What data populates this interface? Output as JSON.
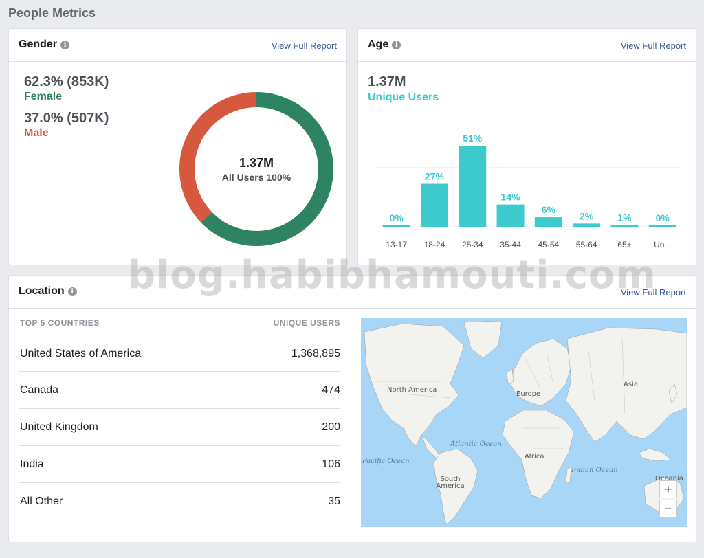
{
  "page": {
    "title": "People Metrics"
  },
  "gender": {
    "title": "Gender",
    "report_link": "View Full Report",
    "female": {
      "value": "62.3% (853K)",
      "label": "Female",
      "percent": 62.3,
      "color": "#2e8362"
    },
    "male": {
      "value": "37.0% (507K)",
      "label": "Male",
      "percent": 37.0,
      "color": "#d6593f"
    },
    "total": "1.37M",
    "total_label": "All Users 100%"
  },
  "age": {
    "title": "Age",
    "report_link": "View Full Report",
    "total": "1.37M",
    "total_label": "Unique Users",
    "accent_color": "#3ccacc"
  },
  "chart_data": {
    "type": "bar",
    "categories": [
      "13-17",
      "18-24",
      "25-34",
      "35-44",
      "45-54",
      "55-64",
      "65+",
      "Un..."
    ],
    "values": [
      0,
      27,
      51,
      14,
      6,
      2,
      1,
      0
    ],
    "data_labels": [
      "0%",
      "27%",
      "51%",
      "14%",
      "6%",
      "2%",
      "1%",
      "0%"
    ],
    "ylim": [
      0,
      51
    ],
    "grid": true
  },
  "location": {
    "title": "Location",
    "report_link": "View Full Report",
    "col_country": "TOP 5 COUNTRIES",
    "col_users": "UNIQUE USERS",
    "rows": [
      {
        "country": "United States of America",
        "users": "1,368,895"
      },
      {
        "country": "Canada",
        "users": "474"
      },
      {
        "country": "United Kingdom",
        "users": "200"
      },
      {
        "country": "India",
        "users": "106"
      },
      {
        "country": "All Other",
        "users": "35"
      }
    ],
    "map": {
      "labels": [
        "North America",
        "South America",
        "Europe",
        "Africa",
        "Asia",
        "Oceania"
      ],
      "oceans": [
        "Atlantic Ocean",
        "Pacific Ocean",
        "Indian Ocean"
      ],
      "zoom_in": "+",
      "zoom_out": "−"
    }
  },
  "watermark": "blog.habibhamouti.com"
}
